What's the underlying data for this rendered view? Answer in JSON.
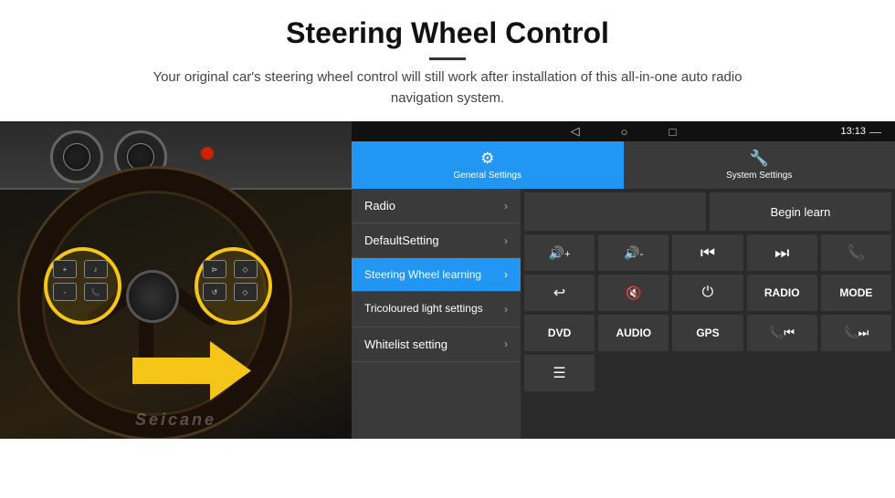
{
  "header": {
    "title": "Steering Wheel Control",
    "subtitle": "Your original car's steering wheel control will still work after installation of this all-in-one auto radio navigation system."
  },
  "statusBar": {
    "time": "13:13",
    "wifiIcon": "▾",
    "signalIcon": "▴"
  },
  "tabs": [
    {
      "label": "General Settings",
      "icon": "⚙",
      "active": true
    },
    {
      "label": "System Settings",
      "icon": "🌐",
      "active": false
    }
  ],
  "menu": {
    "items": [
      {
        "label": "Radio",
        "active": false
      },
      {
        "label": "DefaultSetting",
        "active": false
      },
      {
        "label": "Steering Wheel learning",
        "active": true
      },
      {
        "label": "Tricoloured light settings",
        "active": false
      },
      {
        "label": "Whitelist setting",
        "active": false
      }
    ]
  },
  "rightPanel": {
    "beginLearnLabel": "Begin learn",
    "controls": {
      "row1": [
        {
          "type": "icon",
          "symbol": "🔊+",
          "label": "vol-up"
        },
        {
          "type": "icon",
          "symbol": "🔊-",
          "label": "vol-down"
        },
        {
          "type": "icon",
          "symbol": "⏮",
          "label": "prev"
        },
        {
          "type": "icon",
          "symbol": "⏭",
          "label": "next"
        },
        {
          "type": "icon",
          "symbol": "📞",
          "label": "phone"
        }
      ],
      "row2": [
        {
          "type": "icon",
          "symbol": "↩",
          "label": "back"
        },
        {
          "type": "icon",
          "symbol": "🔇",
          "label": "mute"
        },
        {
          "type": "icon",
          "symbol": "⏻",
          "label": "power"
        },
        {
          "type": "text",
          "symbol": "RADIO",
          "label": "radio"
        },
        {
          "type": "text",
          "symbol": "MODE",
          "label": "mode"
        }
      ],
      "row3": [
        {
          "type": "text",
          "symbol": "DVD",
          "label": "dvd"
        },
        {
          "type": "text",
          "symbol": "AUDIO",
          "label": "audio"
        },
        {
          "type": "text",
          "symbol": "GPS",
          "label": "gps"
        },
        {
          "type": "icon",
          "symbol": "📞⏮",
          "label": "tel-prev"
        },
        {
          "type": "icon",
          "symbol": "📞⏭",
          "label": "tel-next"
        }
      ],
      "row4": [
        {
          "type": "icon",
          "symbol": "☰",
          "label": "menu"
        }
      ]
    }
  },
  "watermark": "Seicane",
  "navBar": {
    "backIcon": "◁",
    "homeIcon": "○",
    "recentIcon": "□",
    "menuIcon": "—"
  }
}
